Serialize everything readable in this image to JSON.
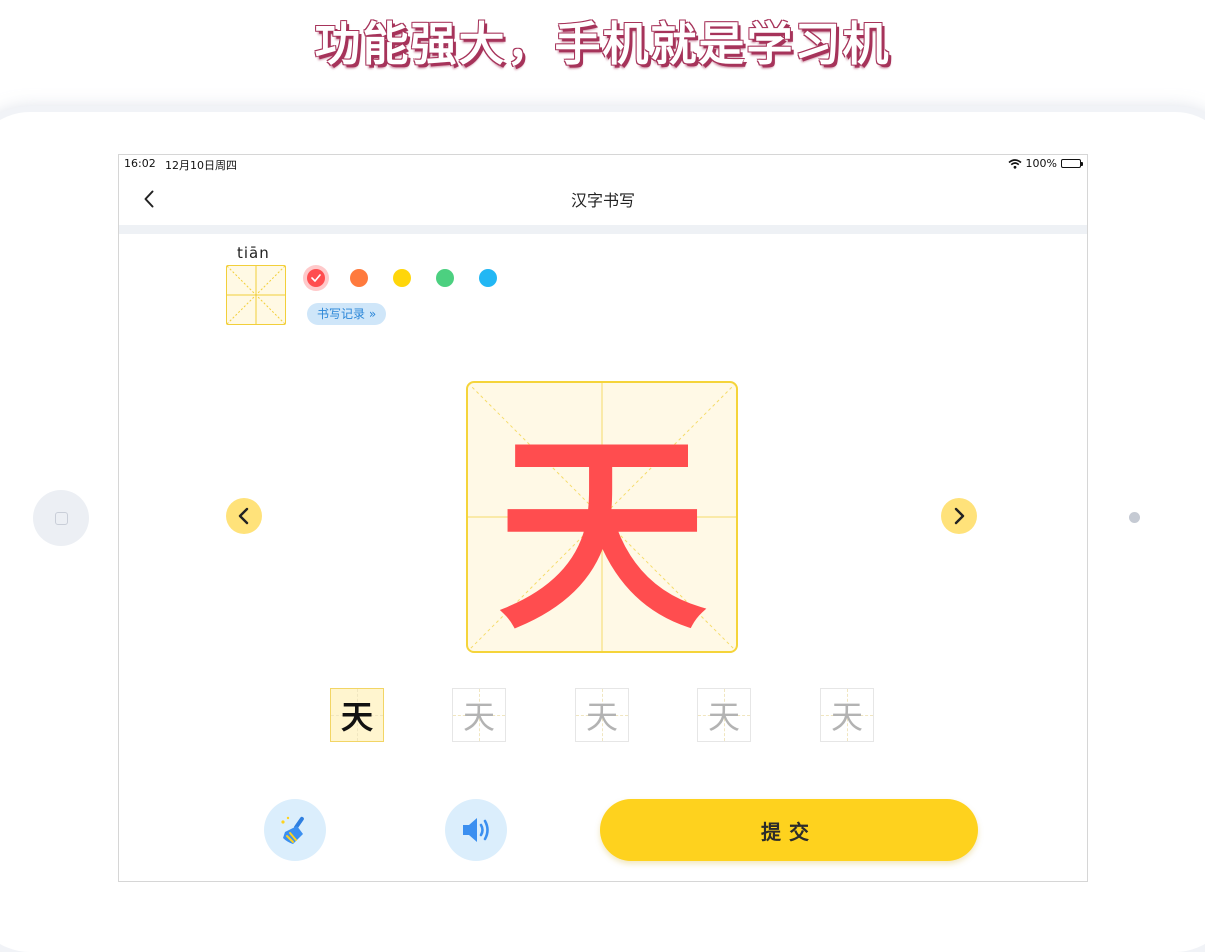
{
  "headline": "功能强大，手机就是学习机",
  "status_bar": {
    "time": "16:02",
    "date": "12月10日周四",
    "battery": "100%"
  },
  "nav": {
    "title": "汉字书写",
    "back_icon": "chevron-left-icon"
  },
  "character": {
    "pinyin": "tiān",
    "char": "天"
  },
  "colors": [
    {
      "name": "red",
      "hex": "#ff4d4f",
      "selected": true
    },
    {
      "name": "orange",
      "hex": "#ff7a3d",
      "selected": false
    },
    {
      "name": "yellow",
      "hex": "#ffd60a",
      "selected": false
    },
    {
      "name": "green",
      "hex": "#4cd080",
      "selected": false
    },
    {
      "name": "blue",
      "hex": "#22b7f4",
      "selected": false
    }
  ],
  "history_button": "书写记录 »",
  "thumbnails": [
    {
      "char": "天",
      "active": true
    },
    {
      "char": "天",
      "active": false
    },
    {
      "char": "天",
      "active": false
    },
    {
      "char": "天",
      "active": false
    },
    {
      "char": "天",
      "active": false
    }
  ],
  "actions": {
    "clear_icon": "broom-icon",
    "sound_icon": "speaker-icon",
    "submit": "提交"
  },
  "theme": {
    "accent": "#fed21e",
    "stroke": "#ff4d4f",
    "grid": "#f5d43a"
  }
}
